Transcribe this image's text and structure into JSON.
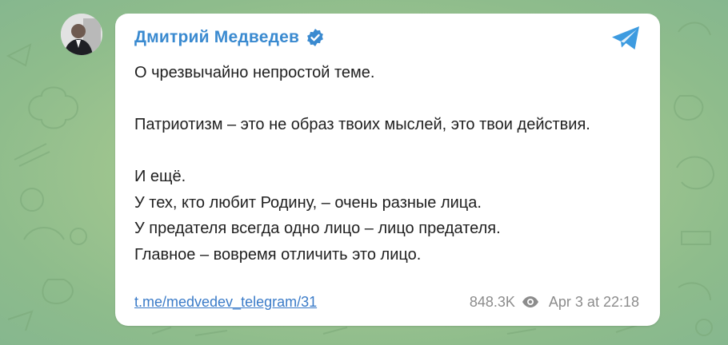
{
  "post": {
    "author": "Дмитрий Медведев",
    "paragraphs": [
      "О чрезвычайно непростой теме.",
      "Патриотизм – это не образ твоих мыслей, это твои действия.",
      "И ещё.\nУ тех, кто любит Родину, – очень разные лица.\nУ предателя всегда одно лицо – лицо предателя.\nГлавное – вовремя отличить это лицо."
    ],
    "link": "t.me/medvedev_telegram/31",
    "views": "848.3K",
    "date": "Apr 3 at 22:18"
  },
  "colors": {
    "author": "#3a8ad0",
    "link": "#3a7bc8",
    "verified_badge": "#3a8ad0",
    "telegram_icon": "#3d9be0",
    "meta_text": "#8c8c8c",
    "background": "#9fc58f"
  },
  "icons": {
    "verified": "verified-icon",
    "telegram": "telegram-icon",
    "views": "eye-icon"
  }
}
